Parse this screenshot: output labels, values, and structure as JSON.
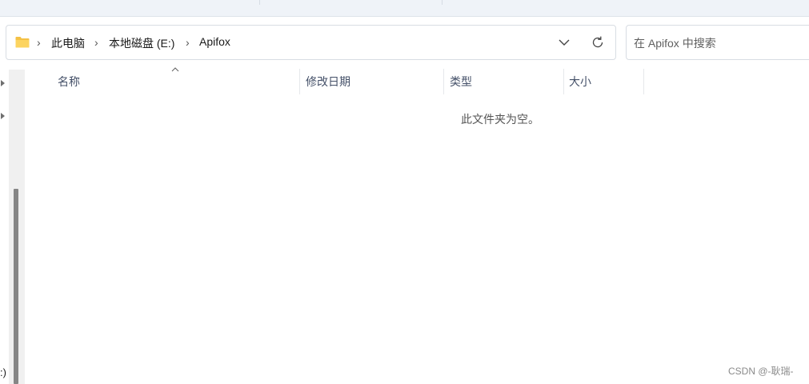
{
  "addressbar": {
    "breadcrumbs": [
      "此电脑",
      "本地磁盘 (E:)",
      "Apifox"
    ],
    "folder_icon": "folder-icon",
    "dropdown_icon": "chevron-down-icon",
    "refresh_icon": "refresh-icon"
  },
  "search": {
    "placeholder": "在 Apifox 中搜索"
  },
  "columns": {
    "name": "名称",
    "modified": "修改日期",
    "type": "类型",
    "size": "大小"
  },
  "main": {
    "empty_message": "此文件夹为空。"
  },
  "nav": {
    "partial_label": ":)"
  },
  "watermark": "CSDN @-耿瑞-"
}
